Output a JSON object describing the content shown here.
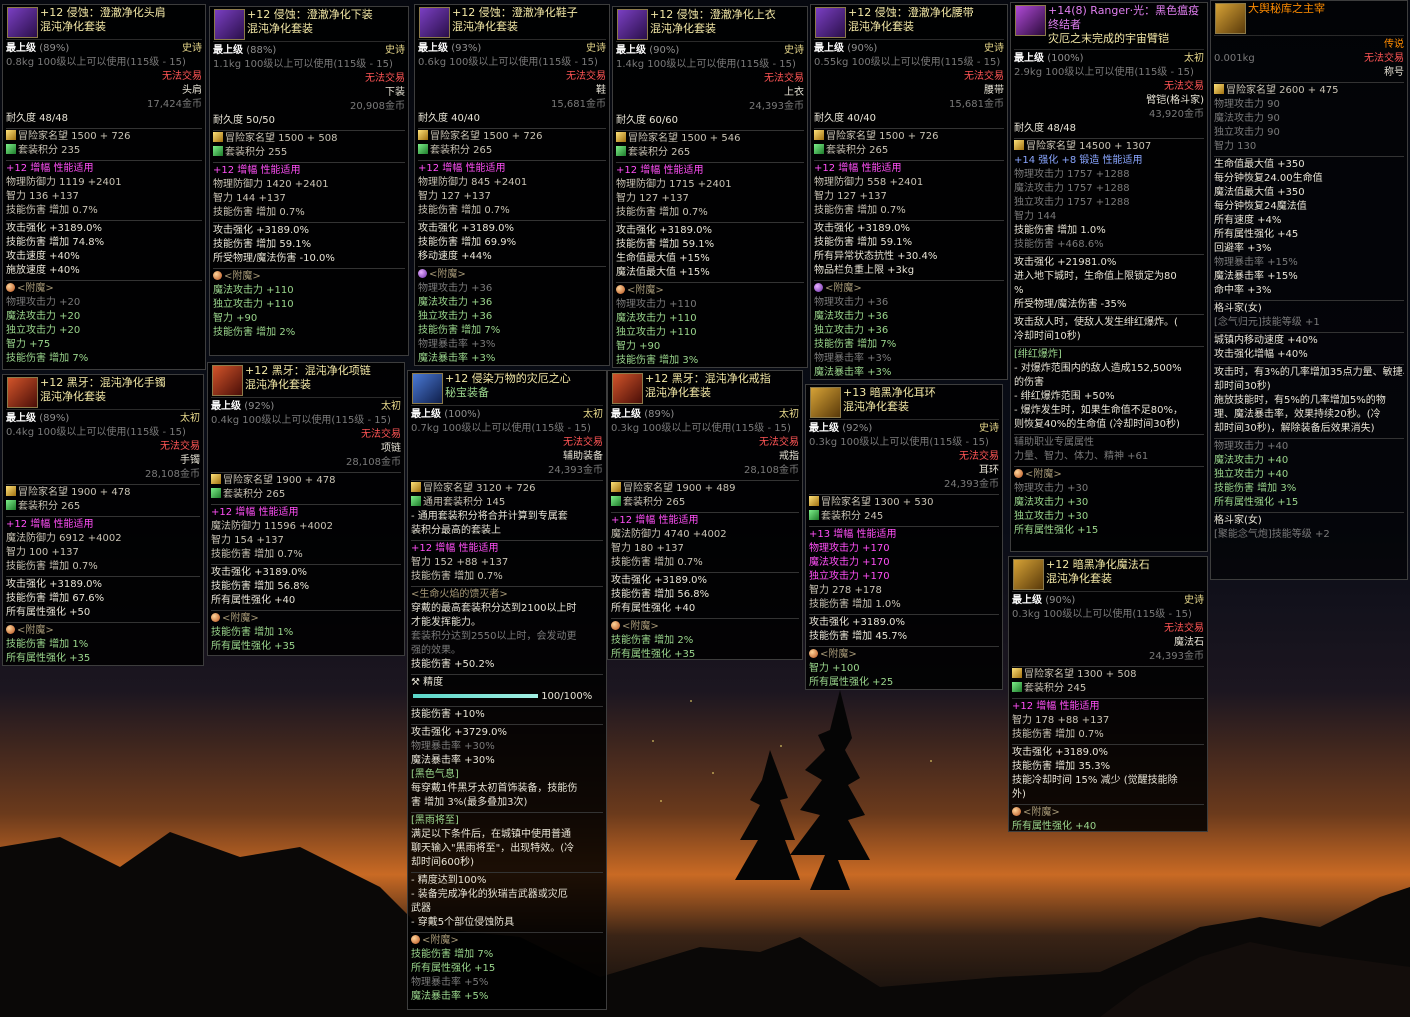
{
  "cards": {
    "c1": {
      "title": "+12 侵蚀：澄澈净化头肩",
      "set": "混沌净化套装",
      "grade": "最上级",
      "pct": "(89%)",
      "rarity": "史诗",
      "weight": "0.8kg",
      "req": "100级以上可以使用(115级 - 15)",
      "trade": "无法交易",
      "slot": "头肩",
      "price": "17,424金币",
      "dur": "耐久度 48/48",
      "rep": "冒险家名望 1500 + 726",
      "score": "套装积分 235",
      "amp": "+12 增幅 性能适用",
      "s1": [
        "物理防御力 1119 +2401",
        "智力 136 +137",
        "技能伤害 增加 0.7%"
      ],
      "s2": [
        "攻击强化 +3189.0%",
        "技能伤害 增加 74.8%",
        "攻击速度 +40%",
        "施放速度 +40%"
      ],
      "enc": "<附魔>",
      "e": [
        "物理攻击力 +20",
        "魔法攻击力 +20",
        "独立攻击力 +20",
        "智力 +75",
        "技能伤害 增加 7%"
      ]
    },
    "c2": {
      "title": "+12 侵蚀：澄澈净化下装",
      "set": "混沌净化套装",
      "grade": "最上级",
      "pct": "(88%)",
      "rarity": "史诗",
      "weight": "1.1kg",
      "req": "100级以上可以使用(115级 - 15)",
      "trade": "无法交易",
      "slot": "下装",
      "price": "20,908金币",
      "dur": "耐久度 50/50",
      "rep": "冒险家名望 1500 + 508",
      "score": "套装积分 255",
      "amp": "+12 增幅 性能适用",
      "s1": [
        "物理防御力 1420 +2401",
        "智力 144 +137",
        "技能伤害 增加 0.7%"
      ],
      "s2": [
        "攻击强化 +3189.0%",
        "技能伤害 增加 59.1%",
        "所受物理/魔法伤害 -10.0%"
      ],
      "enc": "<附魔>",
      "e": [
        "魔法攻击力 +110",
        "独立攻击力 +110",
        "智力 +90",
        "技能伤害 增加 2%"
      ]
    },
    "c3": {
      "title": "+12 侵蚀：澄澈净化鞋子",
      "set": "混沌净化套装",
      "grade": "最上级",
      "pct": "(93%)",
      "rarity": "史诗",
      "weight": "0.6kg",
      "req": "100级以上可以使用(115级 - 15)",
      "trade": "无法交易",
      "slot": "鞋",
      "price": "15,681金币",
      "dur": "耐久度 40/40",
      "rep": "冒险家名望 1500 + 726",
      "score": "套装积分 265",
      "amp": "+12 增幅 性能适用",
      "s1": [
        "物理防御力 845 +2401",
        "智力 127 +137",
        "技能伤害 增加 0.7%"
      ],
      "s2": [
        "攻击强化 +3189.0%",
        "技能伤害 增加 69.9%",
        "移动速度 +44%"
      ],
      "enc": "<附魔>",
      "e": [
        "物理攻击力 +36",
        "魔法攻击力 +36",
        "独立攻击力 +36",
        "技能伤害 增加 7%",
        "物理暴击率 +3%",
        "魔法暴击率 +3%"
      ]
    },
    "c4": {
      "title": "+12 侵蚀：澄澈净化上衣",
      "set": "混沌净化套装",
      "grade": "最上级",
      "pct": "(90%)",
      "rarity": "史诗",
      "weight": "1.4kg",
      "req": "100级以上可以使用(115级 - 15)",
      "trade": "无法交易",
      "slot": "上衣",
      "price": "24,393金币",
      "dur": "耐久度 60/60",
      "rep": "冒险家名望 1500 + 546",
      "score": "套装积分 265",
      "amp": "+12 增幅 性能适用",
      "s1": [
        "物理防御力 1715 +2401",
        "智力 127 +137",
        "技能伤害 增加 0.7%"
      ],
      "s2": [
        "攻击强化 +3189.0%",
        "技能伤害 增加 59.1%",
        "生命值最大值 +15%",
        "魔法值最大值 +15%"
      ],
      "enc": "<附魔>",
      "e": [
        "物理攻击力 +110",
        "魔法攻击力 +110",
        "独立攻击力 +110",
        "智力 +90",
        "技能伤害 增加 3%"
      ]
    },
    "c5": {
      "title": "+12 侵蚀：澄澈净化腰带",
      "set": "混沌净化套装",
      "grade": "最上级",
      "pct": "(90%)",
      "rarity": "史诗",
      "weight": "0.55kg",
      "req": "100级以上可以使用(115级 - 15)",
      "trade": "无法交易",
      "slot": "腰带",
      "price": "15,681金币",
      "dur": "耐久度 40/40",
      "rep": "冒险家名望 1500 + 726",
      "score": "套装积分 265",
      "amp": "+12 增幅 性能适用",
      "s1": [
        "物理防御力 558 +2401",
        "智力 127 +137",
        "技能伤害 增加 0.7%"
      ],
      "s2": [
        "攻击强化 +3189.0%",
        "技能伤害 增加 59.1%",
        "所有异常状态抗性 +30.4%",
        "物品栏负重上限 +3kg"
      ],
      "enc": "<附魔>",
      "e": [
        "物理攻击力 +36",
        "魔法攻击力 +36",
        "独立攻击力 +36",
        "技能伤害 增加 7%",
        "物理暴击率 +3%",
        "魔法暴击率 +3%"
      ]
    },
    "c6": {
      "title": "+14(8) Ranger·光：黑色瘟疫",
      "title2": "终结者",
      "set": "灾厄之末完成的宇宙臂铠",
      "grade": "最上级",
      "pct": "(100%)",
      "rarity": "太初",
      "weight": "2.9kg",
      "req": "100级以上可以使用(115级 - 15)",
      "trade": "无法交易",
      "slot": "臂铠(格斗家)",
      "price": "43,920金币",
      "dur": "耐久度 48/48",
      "rep": "冒险家名望 14500 + 1307",
      "forge": "+14 强化 +8 锻造 性能适用",
      "s1": [
        "物理攻击力 1757 +1288",
        "魔法攻击力 1757 +1288",
        "独立攻击力 1757 +1288",
        "智力 144",
        "技能伤害 增加 1.0%",
        "技能伤害 +468.6%"
      ],
      "s2": [
        "攻击强化 +21981.0%",
        "进入地下城时，生命值上限锁定为80",
        "%",
        "所受物理/魔法伤害 -35%"
      ],
      "s3": [
        "攻击敌人时，使敌人发生绯红爆炸。(",
        "冷却时间10秒)"
      ],
      "sub": "[绯红爆炸]",
      "s4": [
        "- 对爆炸范围内的敌人造成152,500%",
        "的伤害",
        "- 绯红爆炸范围 +50%",
        "- 爆炸发生时，如果生命值不足80%，",
        "则恢复40%的生命值 (冷却时间30秒)"
      ],
      "aux": [
        "辅助职业专属属性",
        "力量、智力、体力、精神 +61"
      ],
      "enc": "<附魔>",
      "e": [
        "物理攻击力 +30",
        "魔法攻击力 +30",
        "独立攻击力 +30",
        "所有属性强化 +15"
      ]
    },
    "c7": {
      "title": "大舆秘库之主宰",
      "grade": "",
      "weight": "0.001kg",
      "rarity": "传说",
      "trade": "无法交易",
      "slot": "称号",
      "rep": "冒险家名望 2600 + 475",
      "s1": [
        "物理攻击力 90",
        "魔法攻击力 90",
        "独立攻击力 90",
        "智力 130"
      ],
      "s2": [
        "生命值最大值 +350",
        "每分钟恢复24.00生命值",
        "魔法值最大值 +350",
        "每分钟恢复24魔法值",
        "所有速度 +4%",
        "所有属性强化 +45",
        "回避率 +3%",
        "物理暴击率 +15%",
        "魔法暴击率 +15%",
        "命中率 +3%"
      ],
      "s3": [
        "格斗家(女)",
        "[念气归元]技能等级 +1"
      ],
      "s4": [
        "城镇内移动速度 +40%",
        "攻击强化增幅 +40%"
      ],
      "s5": [
        "攻击时，有3%的几率增加35点力量、敏捷、体力、精神，效果持续20秒。(冷",
        "却时间30秒)",
        "施放技能时，有5%的几率增加5%的物",
        "理、魔法暴击率，效果持续20秒。(冷",
        "却时间30秒)，解除装备后效果消失)"
      ],
      "e": [
        "物理攻击力 +40",
        "魔法攻击力 +40",
        "独立攻击力 +40",
        "技能伤害 增加 3%",
        "所有属性强化 +15"
      ],
      "s6": [
        "格斗家(女)",
        "[聚能念气炮]技能等级 +2"
      ]
    },
    "c8": {
      "title": "+12 黑牙：混沌净化手镯",
      "set": "混沌净化套装",
      "grade": "最上级",
      "pct": "(89%)",
      "rarity": "太初",
      "weight": "0.4kg",
      "req": "100级以上可以使用(115级 - 15)",
      "trade": "无法交易",
      "slot": "手镯",
      "price": "28,108金币",
      "rep": "冒险家名望 1900 + 478",
      "score": "套装积分 265",
      "amp": "+12 增幅 性能适用",
      "s1": [
        "魔法防御力 6912 +4002",
        "智力 100 +137",
        "技能伤害 增加 0.7%"
      ],
      "s2": [
        "攻击强化 +3189.0%",
        "技能伤害 增加 67.6%",
        "所有属性强化 +50"
      ],
      "enc": "<附魔>",
      "e": [
        "技能伤害 增加 1%",
        "所有属性强化 +35"
      ]
    },
    "c9": {
      "title": "+12 黑牙：混沌净化项链",
      "set": "混沌净化套装",
      "grade": "最上级",
      "pct": "(92%)",
      "rarity": "太初",
      "weight": "0.4kg",
      "req": "100级以上可以使用(115级 - 15)",
      "trade": "无法交易",
      "slot": "项链",
      "price": "28,108金币",
      "rep": "冒险家名望 1900 + 478",
      "score": "套装积分 265",
      "amp": "+12 增幅 性能适用",
      "s1": [
        "魔法防御力 11596 +4002",
        "智力 154 +137",
        "技能伤害 增加 0.7%"
      ],
      "s2": [
        "攻击强化 +3189.0%",
        "技能伤害 增加 56.8%",
        "所有属性强化 +40"
      ],
      "enc": "<附魔>",
      "e": [
        "技能伤害 增加 1%",
        "所有属性强化 +35"
      ]
    },
    "c10": {
      "title": "+12 侵染万物的灾厄之心",
      "set": "秘宝装备",
      "grade": "最上级",
      "pct": "(100%)",
      "rarity": "太初",
      "weight": "0.7kg",
      "req": "100级以上可以使用(115级 - 15)",
      "trade": "无法交易",
      "slot": "辅助装备",
      "price": "24,393金币",
      "rep": "冒险家名望 3120 + 726",
      "score": "通用套装积分 145",
      "note": [
        "- 通用套装积分将合并计算到专属套",
        "装积分最高的套装上"
      ],
      "amp": "+12 增幅 性能适用",
      "s1": [
        "智力 152 +88 +137",
        "技能伤害 增加 0.7%"
      ],
      "t1": "<生命火焰的馈灭者>",
      "s2": [
        "穿戴的最高套装积分达到2100以上时",
        "才能发挥能力。",
        "套装积分达到2550以上时，会发动更",
        "强的效果。"
      ],
      "s2b": "技能伤害 +50.2%",
      "prof": "精度",
      "profv": "100/100%",
      "s3": "技能伤害 +10%",
      "s4": [
        "攻击强化 +3729.0%",
        "物理暴击率 +30%",
        "魔法暴击率 +30%"
      ],
      "t2": "[黑色气息]",
      "s5": [
        "每穿戴1件黑牙太初首饰装备，技能伤",
        "害 增加 3%(最多叠加3次)"
      ],
      "t3": "[黑雨将至]",
      "s6": [
        "满足以下条件后，在城镇中使用普通",
        "聊天输入\"黑雨将至\"，出现特效。(冷",
        "却时间600秒)"
      ],
      "s7": [
        "- 精度达到100%",
        "- 装备完成净化的狄瑞吉武器或灾厄",
        "武器",
        "- 穿戴5个部位侵蚀防具"
      ],
      "enc": "<附魔>",
      "e": [
        "技能伤害 增加 7%",
        "所有属性强化 +15",
        "物理暴击率 +5%",
        "魔法暴击率 +5%"
      ]
    },
    "c11": {
      "title": "+12 黑牙：混沌净化戒指",
      "set": "混沌净化套装",
      "grade": "最上级",
      "pct": "(89%)",
      "rarity": "太初",
      "weight": "0.3kg",
      "req": "100级以上可以使用(115级 - 15)",
      "trade": "无法交易",
      "slot": "戒指",
      "price": "28,108金币",
      "rep": "冒险家名望 1900 + 489",
      "score": "套装积分 265",
      "amp": "+12 增幅 性能适用",
      "s1": [
        "魔法防御力 4740 +4002",
        "智力 180 +137",
        "技能伤害 增加 0.7%"
      ],
      "s2": [
        "攻击强化 +3189.0%",
        "技能伤害 增加 56.8%",
        "所有属性强化 +40"
      ],
      "enc": "<附魔>",
      "e": [
        "技能伤害 增加 2%",
        "所有属性强化 +35"
      ]
    },
    "c12": {
      "title": "+13 暗黑净化耳环",
      "set": "混沌净化套装",
      "grade": "最上级",
      "pct": "(92%)",
      "rarity": "史诗",
      "weight": "0.3kg",
      "req": "100级以上可以使用(115级 - 15)",
      "trade": "无法交易",
      "slot": "耳环",
      "price": "24,393金币",
      "rep": "冒险家名望 1300 + 530",
      "score": "套装积分 245",
      "amp": "+13 增幅 性能适用",
      "s1": [
        "物理攻击力 +170",
        "魔法攻击力 +170",
        "独立攻击力 +170",
        "智力 278 +178",
        "技能伤害 增加 1.0%"
      ],
      "s2": [
        "攻击强化 +3189.0%",
        "技能伤害 增加 45.7%"
      ],
      "enc": "<附魔>",
      "e": [
        "智力 +100",
        "所有属性强化 +25"
      ]
    },
    "c13": {
      "title": "+12 暗黑净化魔法石",
      "set": "混沌净化套装",
      "grade": "最上级",
      "pct": "(90%)",
      "rarity": "史诗",
      "weight": "0.3kg",
      "req": "100级以上可以使用(115级 - 15)",
      "trade": "无法交易",
      "slot": "魔法石",
      "price": "24,393金币",
      "rep": "冒险家名望 1300 + 508",
      "score": "套装积分 245",
      "amp": "+12 增幅 性能适用",
      "s1": [
        "智力 178 +88 +137",
        "技能伤害 增加 0.7%"
      ],
      "s2": [
        "攻击强化 +3189.0%",
        "技能伤害 增加 35.3%",
        "技能冷却时间 15% 减少 (觉醒技能除",
        "外)"
      ],
      "enc": "<附魔>",
      "e": [
        "所有属性强化 +40"
      ]
    }
  },
  "precision_pct": 100,
  "colors": {
    "legend": "#ff8c00",
    "epic": "#f3e8a6",
    "gold": "#e7d88b",
    "trade": "#ff5555",
    "rarity_epic": "#e4b23a",
    "rarity_primal": "#e8d36a",
    "rarity_legend": "#ff8c00",
    "amp": "#ff4ff6",
    "bonus": "#ff4ff6"
  }
}
